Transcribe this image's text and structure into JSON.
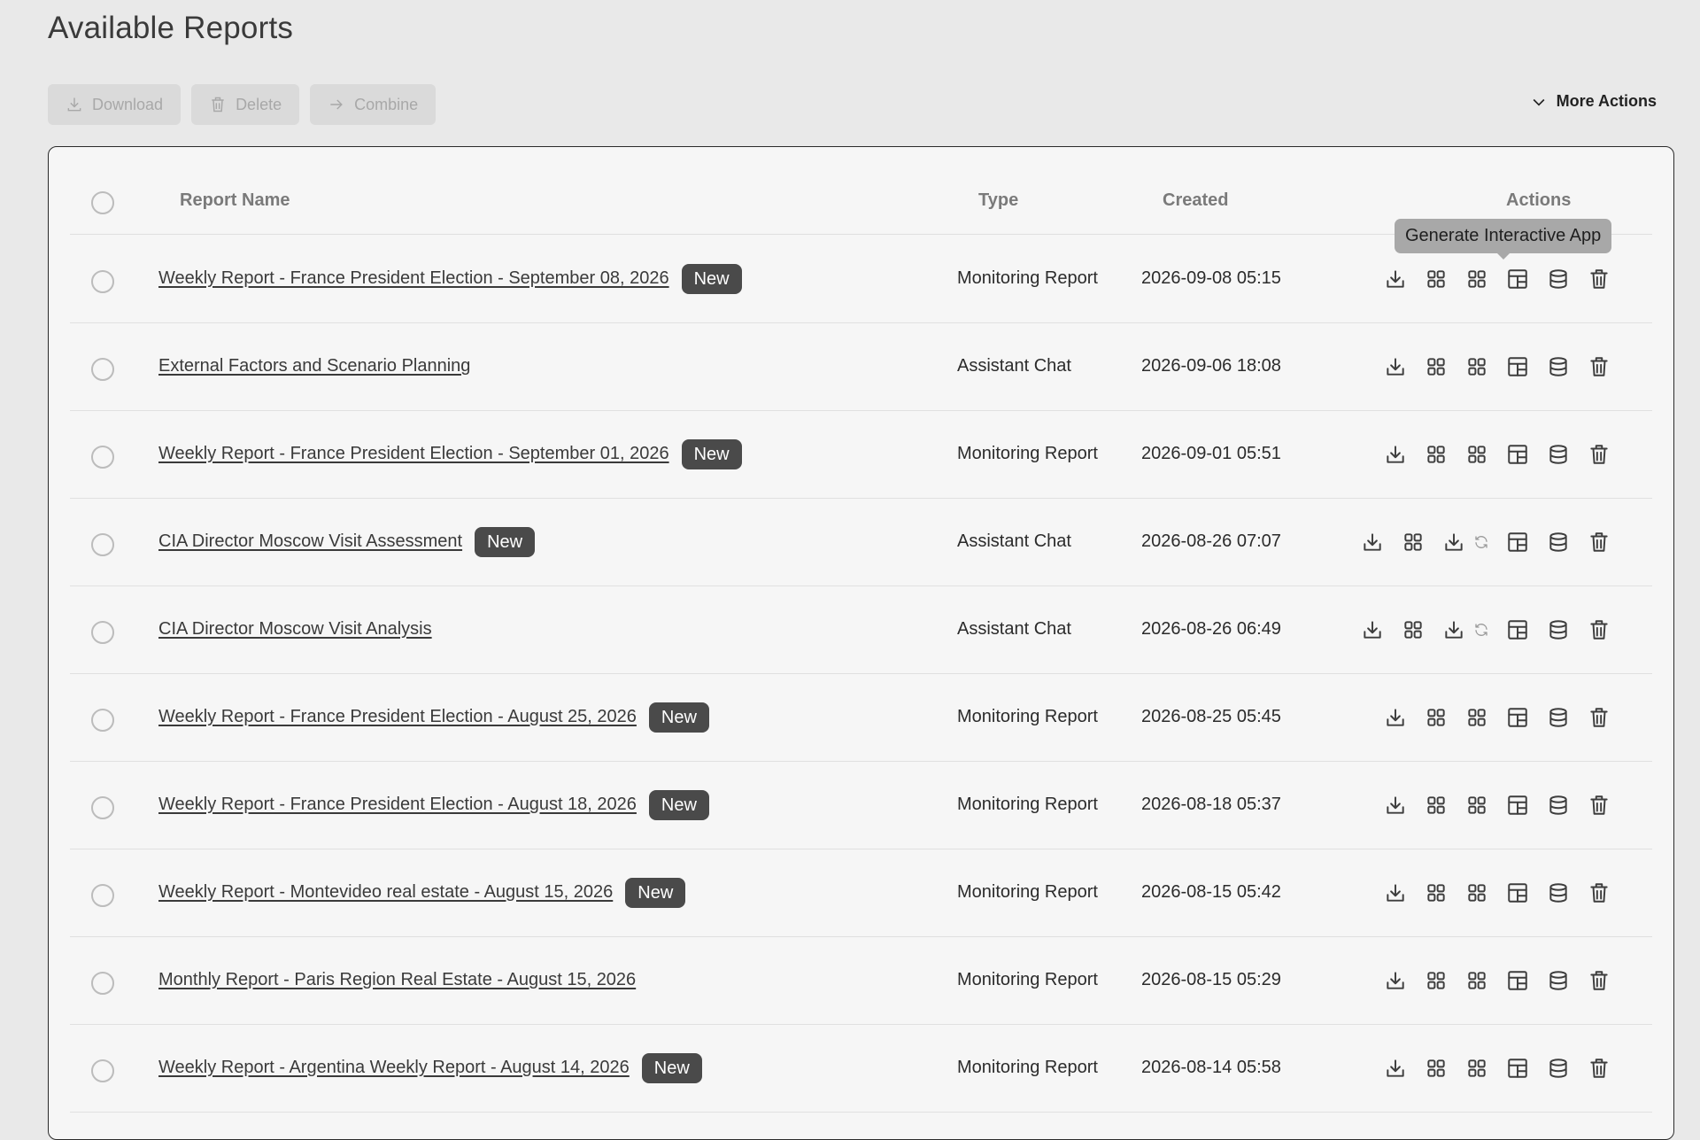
{
  "page": {
    "title": "Available Reports"
  },
  "toolbar": {
    "download_label": "Download",
    "delete_label": "Delete",
    "combine_label": "Combine",
    "more_actions_label": "More Actions"
  },
  "table": {
    "headers": {
      "name": "Report Name",
      "type": "Type",
      "created": "Created",
      "actions": "Actions"
    },
    "tooltip": "Generate Interactive App",
    "badge_label": "New",
    "rows": [
      {
        "name": "Weekly Report - France President Election - September 08, 2026",
        "badge": true,
        "type": "Monitoring Report",
        "created": "2026-09-08 05:15",
        "variant": "standard"
      },
      {
        "name": "External Factors and Scenario Planning",
        "badge": false,
        "type": "Assistant Chat",
        "created": "2026-09-06 18:08",
        "variant": "standard"
      },
      {
        "name": "Weekly Report - France President Election - September 01, 2026",
        "badge": true,
        "type": "Monitoring Report",
        "created": "2026-09-01 05:51",
        "variant": "standard"
      },
      {
        "name": "CIA Director Moscow Visit Assessment",
        "badge": true,
        "type": "Assistant Chat",
        "created": "2026-08-26 07:07",
        "variant": "processing"
      },
      {
        "name": "CIA Director Moscow Visit Analysis",
        "badge": false,
        "type": "Assistant Chat",
        "created": "2026-08-26 06:49",
        "variant": "processing"
      },
      {
        "name": "Weekly Report - France President Election - August 25, 2026",
        "badge": true,
        "type": "Monitoring Report",
        "created": "2026-08-25 05:45",
        "variant": "standard"
      },
      {
        "name": "Weekly Report - France President Election - August 18, 2026",
        "badge": true,
        "type": "Monitoring Report",
        "created": "2026-08-18 05:37",
        "variant": "standard"
      },
      {
        "name": "Weekly Report - Montevideo real estate - August 15, 2026",
        "badge": true,
        "type": "Monitoring Report",
        "created": "2026-08-15 05:42",
        "variant": "standard"
      },
      {
        "name": "Monthly Report - Paris Region Real Estate - August 15, 2026",
        "badge": false,
        "type": "Monitoring Report",
        "created": "2026-08-15 05:29",
        "variant": "standard"
      },
      {
        "name": "Weekly Report - Argentina Weekly Report - August 14, 2026",
        "badge": true,
        "type": "Monitoring Report",
        "created": "2026-08-14 05:58",
        "variant": "standard"
      }
    ],
    "action_icons": {
      "standard": [
        "download-icon",
        "grid-icon",
        "grid-icon",
        "layout-icon",
        "database-icon",
        "trash-icon"
      ],
      "processing": [
        "download-icon",
        "grid-icon",
        "download-icon",
        "sync-icon",
        "layout-icon",
        "database-icon",
        "trash-icon"
      ]
    }
  }
}
